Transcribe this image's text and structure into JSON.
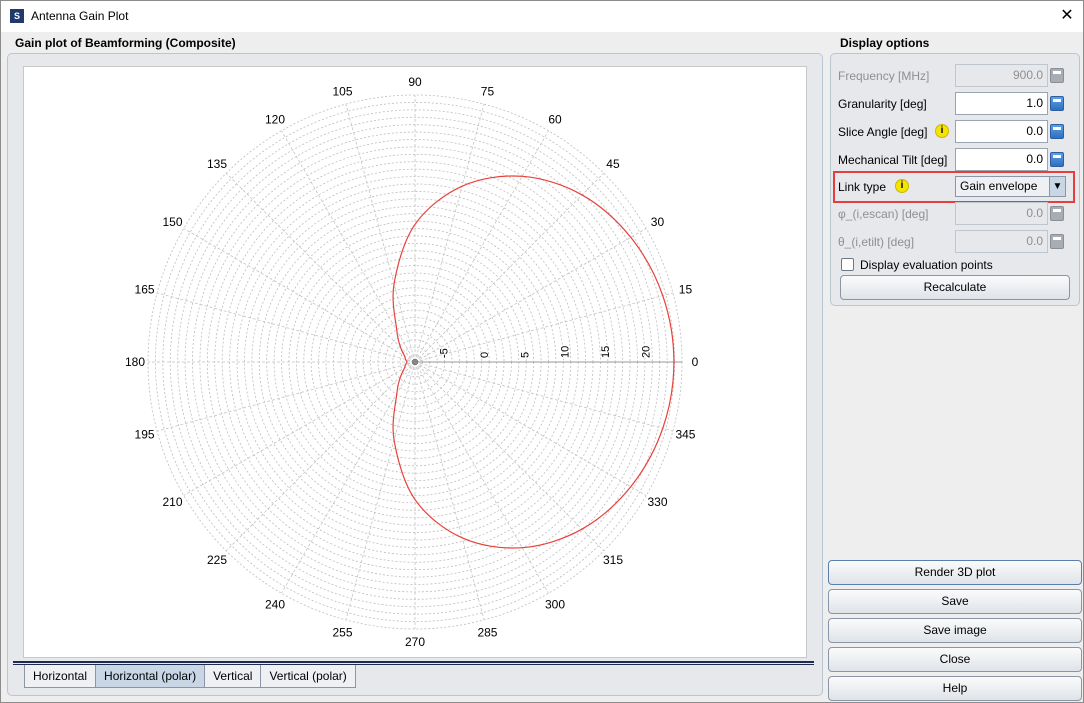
{
  "window": {
    "title": "Antenna Gain Plot",
    "app_icon": "S"
  },
  "plot": {
    "title": "Gain plot of Beamforming (Composite)"
  },
  "tabs": [
    "Horizontal",
    "Horizontal (polar)",
    "Vertical",
    "Vertical (polar)"
  ],
  "active_tab": "Horizontal (polar)",
  "options": {
    "title": "Display options",
    "frequency": {
      "label": "Frequency [MHz]",
      "value": "900.0"
    },
    "granularity": {
      "label": "Granularity [deg]",
      "value": "1.0"
    },
    "slice_angle": {
      "label": "Slice Angle [deg]",
      "value": "0.0"
    },
    "mechanical_tilt": {
      "label": "Mechanical Tilt [deg]",
      "value": "0.0"
    },
    "link_type": {
      "label": "Link type",
      "value": "Gain envelope"
    },
    "phi_escan": {
      "label": "φ_(i,escan) [deg]",
      "value": "0.0"
    },
    "theta_etilt": {
      "label": "θ_(i,etilt) [deg]",
      "value": "0.0"
    },
    "display_eval_points": "Display evaluation points",
    "recalculate": "Recalculate",
    "info_glyph": "i"
  },
  "buttons": {
    "render3d": "Render 3D plot",
    "save": "Save",
    "save_image": "Save image",
    "close": "Close",
    "help": "Help"
  },
  "chart_data": {
    "type": "polar-line",
    "angle_labels": [
      "0",
      "15",
      "30",
      "45",
      "60",
      "75",
      "90",
      "105",
      "120",
      "135",
      "150",
      "165",
      "180",
      "195",
      "210",
      "225",
      "240",
      "255",
      "270",
      "285",
      "300",
      "315",
      "330",
      "345"
    ],
    "radial_tick_labels": [
      "-5",
      "0",
      "5",
      "10",
      "15",
      "20"
    ],
    "radial_range_db": [
      -9,
      24
    ],
    "series": [
      {
        "color": "#e8413b",
        "points": [
          {
            "angle": 0,
            "gain": 23.0
          },
          {
            "angle": 15,
            "gain": 22.7
          },
          {
            "angle": 30,
            "gain": 21.8
          },
          {
            "angle": 45,
            "gain": 20.2
          },
          {
            "angle": 60,
            "gain": 17.5
          },
          {
            "angle": 75,
            "gain": 13.5
          },
          {
            "angle": 90,
            "gain": 8.0
          },
          {
            "angle": 105,
            "gain": 1.0
          },
          {
            "angle": 120,
            "gain": -4.5
          },
          {
            "angle": 135,
            "gain": -6.5
          },
          {
            "angle": 150,
            "gain": -7.5
          },
          {
            "angle": 165,
            "gain": -7.8
          },
          {
            "angle": 180,
            "gain": -8.0
          },
          {
            "angle": 195,
            "gain": -7.8
          },
          {
            "angle": 210,
            "gain": -7.5
          },
          {
            "angle": 225,
            "gain": -6.5
          },
          {
            "angle": 240,
            "gain": -4.5
          },
          {
            "angle": 255,
            "gain": 1.0
          },
          {
            "angle": 270,
            "gain": 8.0
          },
          {
            "angle": 285,
            "gain": 13.5
          },
          {
            "angle": 300,
            "gain": 17.5
          },
          {
            "angle": 315,
            "gain": 20.2
          },
          {
            "angle": 330,
            "gain": 21.8
          },
          {
            "angle": 345,
            "gain": 22.7
          }
        ]
      }
    ]
  }
}
